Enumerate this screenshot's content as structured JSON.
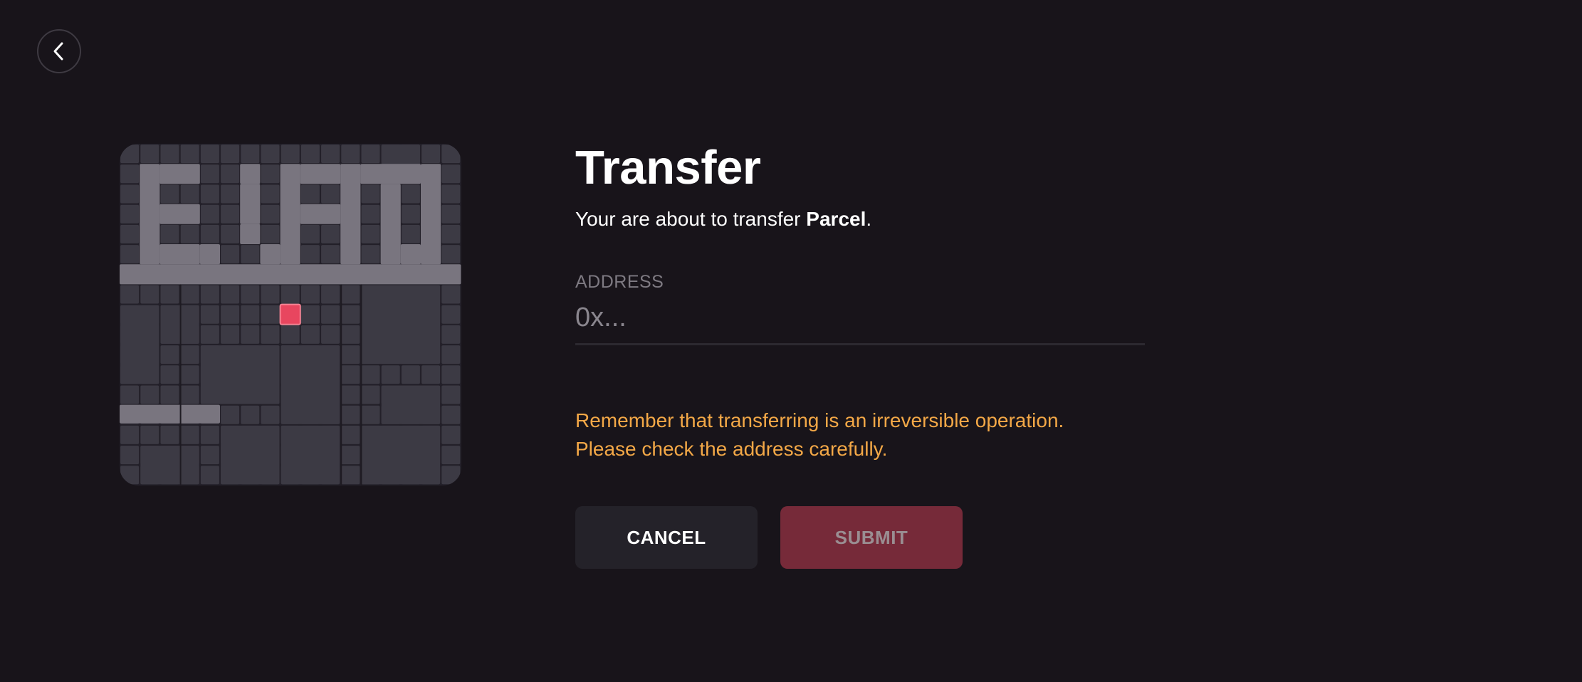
{
  "header": {
    "back_icon": "chevron-left-icon"
  },
  "parcel_map": {
    "colors": {
      "background": "#232029",
      "parcel": "#3c3a44",
      "district": "#79757f",
      "selected": "#e8465f"
    }
  },
  "transfer": {
    "title": "Transfer",
    "subtitle_prefix": "Your are about to transfer ",
    "subtitle_item": "Parcel",
    "subtitle_suffix": ".",
    "address_label": "ADDRESS",
    "address_placeholder": "0x...",
    "address_value": "",
    "warning_line1": "Remember that transferring is an irreversible operation.",
    "warning_line2": "Please check the address carefully."
  },
  "actions": {
    "cancel_label": "CANCEL",
    "submit_label": "SUBMIT",
    "colors": {
      "cancel_bg": "#242229",
      "submit_bg": "#762a39",
      "warning": "#f3a847"
    }
  }
}
